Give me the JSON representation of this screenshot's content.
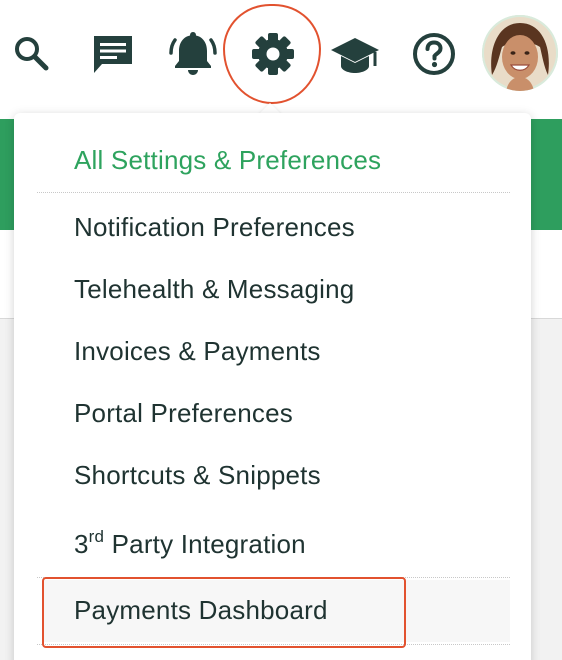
{
  "topbar": {
    "icons": [
      "search-icon",
      "messages-icon",
      "bell-icon",
      "gear-icon",
      "graduation-cap-icon",
      "help-icon"
    ],
    "icon_color": "#24403d",
    "highlight_color": "#e2522f"
  },
  "menu": {
    "all_settings": "All Settings & Preferences",
    "items": [
      "Notification Preferences",
      "Telehealth & Messaging",
      "Invoices & Payments",
      "Portal Preferences",
      "Shortcuts & Snippets"
    ],
    "third_party": {
      "prefix": "3",
      "superscript": "rd",
      "suffix": " Party Integration"
    },
    "payments_dashboard": "Payments Dashboard",
    "accent_color": "#2ea35e"
  }
}
